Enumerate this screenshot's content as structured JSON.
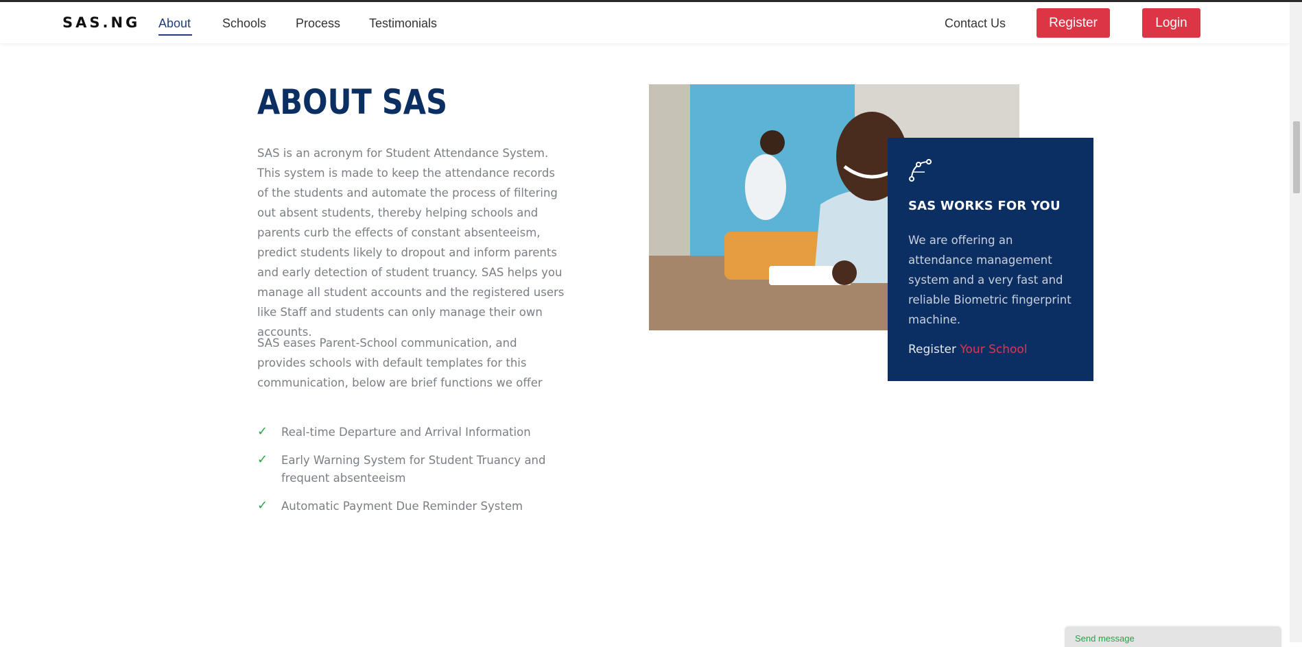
{
  "nav": {
    "brand": "SAS.NG",
    "links": [
      "About",
      "Schools",
      "Process",
      "Testimonials"
    ],
    "contact": "Contact Us",
    "register": "Register",
    "login": "Login"
  },
  "about": {
    "title": "ABOUT SAS",
    "paragraph1": "SAS is an acronym for Student Attendance System. This system is made to keep the attendance records of the students and automate the process of filtering out absent students, thereby helping schools and parents curb the effects of constant absenteeism, predict students likely to dropout and inform parents and early detection of student truancy. SAS helps you manage all student accounts and the registered users like Staff and students can only manage their own accounts.",
    "paragraph2": "SAS eases Parent-School communication, and provides schools with default templates for this communication, below are brief functions we offer",
    "features": [
      "Real-time Departure and Arrival Information",
      "Early Warning System for Student Truancy and frequent absenteeism",
      "Automatic Payment Due Reminder System"
    ]
  },
  "card": {
    "icon": "bezier-curve-icon",
    "title": "SAS WORKS FOR YOU",
    "text": "We are offering an attendance management system and a very fast and reliable Biometric fingerprint machine.",
    "register_prefix": "Register",
    "register_link": "Your School"
  },
  "chat": {
    "label": "Send message"
  },
  "colors": {
    "primary": "#0c2f63",
    "accent": "#dc3545",
    "check": "#28a745"
  }
}
